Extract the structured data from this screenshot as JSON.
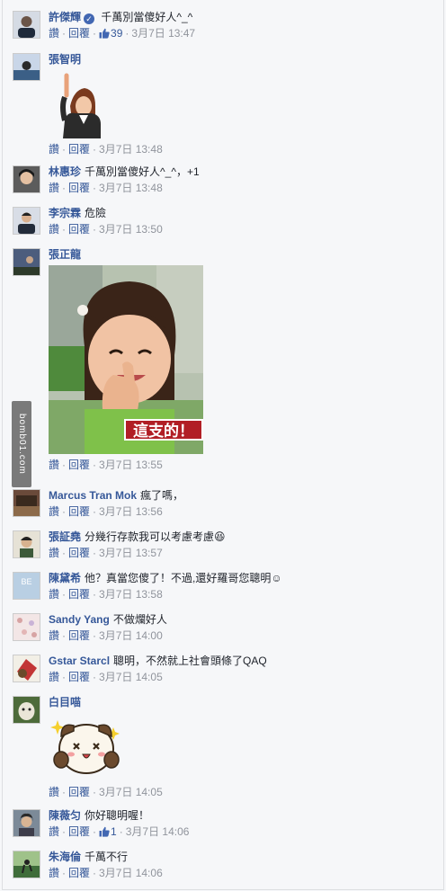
{
  "actions": {
    "like": "讚",
    "reply": "回覆",
    "dot": "·"
  },
  "comments": [
    {
      "name": "許傑輝",
      "verified": true,
      "text": "千萬別當傻好人^_^",
      "likes": "39",
      "time": "3月7日 13:47",
      "avatar_color": "#a7b4c8"
    },
    {
      "name": "張智明",
      "text": "",
      "time": "3月7日 13:48",
      "avatar_color": "#5f79a0"
    },
    {
      "name": "林惠珍",
      "text": "千萬別當傻好人^_^，+1",
      "time": "3月7日 13:48",
      "avatar_color": "#3b3b3b"
    },
    {
      "name": "李宗霖",
      "text": "危險",
      "time": "3月7日 13:50",
      "avatar_color": "#2c3a55"
    },
    {
      "name": "張正龍",
      "text": "",
      "time": "3月7日 13:55",
      "avatar_color": "#4c5d7d",
      "image_caption": "這支的！"
    },
    {
      "name": "Marcus Tran Mok",
      "text": "瘋了嗎，",
      "time": "3月7日 13:56",
      "avatar_color": "#6a4a3a"
    },
    {
      "name": "張証堯",
      "text": "分幾行存款我可以考慮考慮😆",
      "time": "3月7日 13:57",
      "avatar_color": "#c9c0a8"
    },
    {
      "name": "陳黛希",
      "text": "他？真當您傻了！不過,還好羅哥您聰明☺",
      "time": "3月7日 13:58",
      "avatar_color": "#b9cfe3",
      "avatar_text": "BE"
    },
    {
      "name": "Sandy Yang",
      "text": "不做爛好人",
      "time": "3月7日 14:00",
      "avatar_color": "#e8d3d3"
    },
    {
      "name": "Gstar Starcl",
      "text": "聰明，不然就上社會頭條了QAQ",
      "time": "3月7日 14:05",
      "avatar_color": "#b33c3c"
    },
    {
      "name": "白目喵",
      "text": "",
      "time": "3月7日 14:05",
      "avatar_color": "#4d6b3a"
    },
    {
      "name": "陳薇匀",
      "text": "你好聰明喔！",
      "likes": "1",
      "time": "3月7日 14:06",
      "avatar_color": "#56667a"
    },
    {
      "name": "朱海倫",
      "text": "千萬不行",
      "time": "3月7日 14:06",
      "avatar_color": "#3f6d3a"
    }
  ],
  "watermark": "bomb01.com"
}
